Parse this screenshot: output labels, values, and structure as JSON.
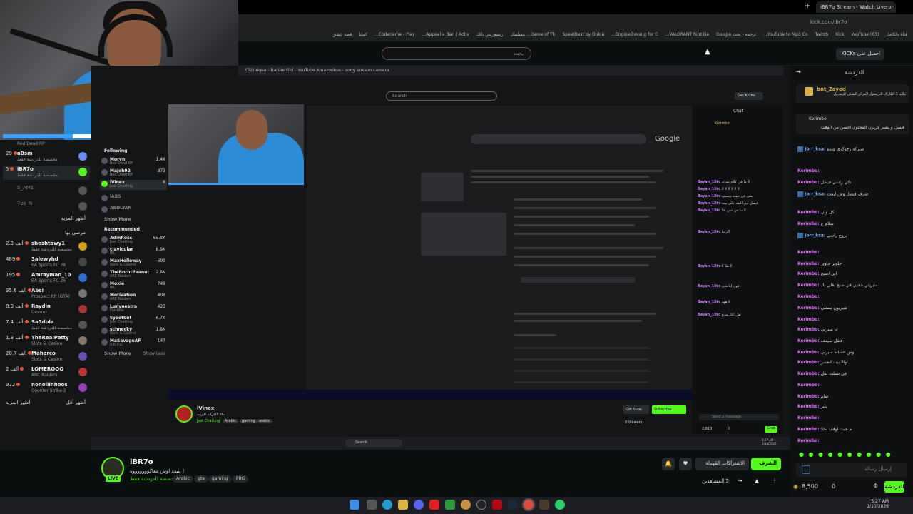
{
  "browser": {
    "active_tab": "iBR7o Stream - Watch Live on Kick",
    "new_tab_symbol": "+",
    "address": "kick.com/ibr7o",
    "bookmarks": [
      "قناة بالكامل",
      "YouTube (63)",
      "Kick",
      "Twitch",
      "YouTube to Mp3 Co...",
      "ترجمه - بحث Google",
      "VALORANT Riot Ga...",
      "EngineOwning for C...",
      "Speedtest by Ookla",
      "Game of Th... مسلسل",
      "زيسوريس بالك",
      "Appeal a Ban | Activ...",
      "Codename - Play...",
      "كمانا",
      "قصة عشق"
    ]
  },
  "kick_header": {
    "search_placeholder": "بحث",
    "get_kick_button": "احصل على KICKs"
  },
  "left_sidebar": {
    "top_item": {
      "name": "",
      "game": "Red Dead RP"
    },
    "items": [
      {
        "count": "29",
        "name": "aBsm",
        "game": "مخصصة للدردشة فقط",
        "color": "#6b8cff"
      },
      {
        "count": "5",
        "name": "iBR7o",
        "game": "مخصصة للدردشة فقط",
        "color": "#53fc18"
      },
      {
        "count": "",
        "name": "S_AM1",
        "game": "",
        "color": "#555"
      },
      {
        "count": "",
        "name": "7os_N",
        "game": "",
        "color": "#555"
      }
    ],
    "show_more_1": "أظهر المزيد",
    "recommended_heading": "مرصى بها",
    "recommended": [
      {
        "count": "2.3 ألف",
        "name": "sheshtawy1",
        "game": "مخصصة للدردشة فقط"
      },
      {
        "count": "489",
        "name": "3alewyhd",
        "game": "EA Sports FC 26"
      },
      {
        "count": "195",
        "name": "Amrayman_10",
        "game": "EA Sports FC 26"
      },
      {
        "count": "35.6 ألف",
        "name": "Absi",
        "game": "Prospect RP (GTA)"
      },
      {
        "count": "8.9 ألف",
        "name": "Raydin",
        "game": "Devour"
      },
      {
        "count": "7.4 ألف",
        "name": "Sa3dola",
        "game": "مخصصة للدردشة فقط"
      },
      {
        "count": "1.3 ألف",
        "name": "TheRealPatty",
        "game": "Slots & Casino"
      },
      {
        "count": "20.7 ألف",
        "name": "Maherco",
        "game": "Slots & Casino"
      },
      {
        "count": "2 ألف",
        "name": "LOMEROOO",
        "game": "ARC Raiders"
      },
      {
        "count": "972",
        "name": "nonoliinhoos",
        "game": "Counter-Strike 2"
      }
    ],
    "show_more_2": "أظهر المزيد",
    "show_less": "أظهر أقل"
  },
  "inner_screen": {
    "tabs": "(52) Aqua - Barbie Girl - YouTube   Amazonkus - sony stream camera",
    "search_placeholder": "Search",
    "get_kicks": "Get KICKs",
    "following_heading": "Following",
    "following": [
      {
        "name": "Morvn",
        "sub": "Red Dead RP",
        "count": "1.4K"
      },
      {
        "name": "Majeh92",
        "sub": "Red Dead RP",
        "count": "873"
      },
      {
        "name": "iVinex",
        "sub": "Just Chatting",
        "count": "8"
      },
      {
        "name": "iABS",
        "sub": "",
        "count": ""
      },
      {
        "name": "ABDLYAN",
        "sub": "",
        "count": ""
      }
    ],
    "show_more": "Show More",
    "recommended_heading": "Recommended",
    "recommended": [
      {
        "name": "AdinRoss",
        "sub": "Just Chatting",
        "count": "65.8K"
      },
      {
        "name": "clavicular",
        "sub": "IRL",
        "count": "8.9K"
      },
      {
        "name": "MaxHolloway",
        "sub": "Slots & Casino",
        "count": "699"
      },
      {
        "name": "TheBurntPeanut",
        "sub": "ARC Raiders",
        "count": "2.8K"
      },
      {
        "name": "Moxie",
        "sub": "IRL",
        "count": "749"
      },
      {
        "name": "Motivation",
        "sub": "ARC Raiders",
        "count": "408"
      },
      {
        "name": "Lunynestra",
        "sub": "Fortnite",
        "count": "423"
      },
      {
        "name": "kyootbot",
        "sub": "Just Chatting",
        "count": "6.7K"
      },
      {
        "name": "schnecky",
        "sub": "Slots & Casino",
        "count": "1.8K"
      },
      {
        "name": "MaSavageAF",
        "sub": "R.E.P.O.",
        "count": "147"
      }
    ],
    "show_more_2": "Show More",
    "show_less": "Show Less",
    "google_logo": "Google",
    "chat_title": "Chat",
    "chat_pinned_user": "Kerimbo",
    "chat_messages": [
      {
        "user": "Bayan_10rc",
        "text": "لا ما في كلام سرنه"
      },
      {
        "user": "Bayan_10rc",
        "text": "لا لا لا لا لا لا"
      },
      {
        "user": "Bayan_10rc",
        "text": "متى في حفله رسمي"
      },
      {
        "user": "Bayan_10rc",
        "text": "فيصل ابي البث على بيت"
      },
      {
        "user": "Bayan_10rc",
        "text": "لا ما في شي هلا"
      },
      {
        "user": "Bayan_10rc",
        "text": "الرانيا"
      },
      {
        "user": "Bayan_10rc",
        "text": "لا هلا لا"
      },
      {
        "user": "Bayan_10rc",
        "text": "قول لنا شي"
      },
      {
        "user": "Bayan_10rc",
        "text": "لا ههه"
      },
      {
        "user": "Bayan_10rc",
        "text": "نقل انك مذيع"
      }
    ],
    "send_placeholder": "Send a message",
    "chat_send": "Chat",
    "points": "2,810",
    "zero": "0",
    "streamer_name": "iVinex",
    "streamer_title": "ملك الكراث البرتبه",
    "streamer_cat": "Just Chatting",
    "streamer_tags": [
      "Arabic",
      "gaming",
      "arabic"
    ],
    "gift_sub": "Gift Subs",
    "subscribe": "Subscribe",
    "viewers": "8 Viewers",
    "taskbar_search": "Search",
    "clock": "5:27 AM\n1/10/2026"
  },
  "stream": {
    "streamer_name": "iBR7o",
    "live": "LIVE",
    "title": "بثيت اوش معاكوووووووه !",
    "category": "مخصصة للدردشة فقط",
    "tags": [
      "Arabic",
      "gta",
      "gaming",
      "FRG"
    ],
    "follow_button": "الشرف",
    "subs_button": "الاشتراكات المُهداة",
    "viewers": "5 المشاهدين",
    "bell_icon": "bell-icon",
    "heart_icon": "heart-icon"
  },
  "chat": {
    "title": "الدردشة",
    "pinned_user": "bnt_Zayed",
    "pinned_text": "إعلانه 1 الكاراك الـرسـول المركز الشـان الرسـول",
    "pinned2_user": "Kerimbo",
    "pinned2_text": "فيصل و بشير كريرن المحتوى احسن من الوقت",
    "messages": [
      {
        "user": "Jorr_ksa:",
        "text": "سيركه رجوكري وووو",
        "style": "u2"
      },
      {
        "user": "Kerimbo:",
        "text": "",
        "style": "u"
      },
      {
        "user": "Kerimbo:",
        "text": "نكي راسي فيصل",
        "style": "u"
      },
      {
        "user": "Jorr_ksa:",
        "text": "شرف فيصل وش ليمت",
        "style": "u2"
      },
      {
        "user": "Kerimbo:",
        "text": "كل ولي",
        "style": "u"
      },
      {
        "user": "Kerimbo:",
        "text": "سلام ج",
        "style": "u"
      },
      {
        "user": "Jorr_ksa:",
        "text": "بروح راسي",
        "style": "u2"
      },
      {
        "user": "Kerimbo:",
        "text": "",
        "style": "u"
      },
      {
        "user": "Kerimbo:",
        "text": "خلوير خلوير",
        "style": "u"
      },
      {
        "user": "Kerimbo:",
        "text": "ابي اصبح",
        "style": "u"
      },
      {
        "user": "Kerimbo:",
        "text": "سيريني حجيي في صبح اهلي بك",
        "style": "u"
      },
      {
        "user": "Kerimbo:",
        "text": "",
        "style": "u"
      },
      {
        "user": "Kerimbo:",
        "text": "شيريون يستلي",
        "style": "u"
      },
      {
        "user": "Kerimbo:",
        "text": "",
        "style": "u"
      },
      {
        "user": "Kerimbo:",
        "text": "انا سيرلي",
        "style": "u"
      },
      {
        "user": "Kerimbo:",
        "text": "فتقل سيمعه",
        "style": "u"
      },
      {
        "user": "Kerimbo:",
        "text": "وش عسانه سيرلي",
        "style": "u"
      },
      {
        "user": "Kerimbo:",
        "text": "اوالا بيت القسر",
        "style": "u"
      },
      {
        "user": "Kerimbo:",
        "text": "في تسلت تمل",
        "style": "u"
      },
      {
        "user": "Kerimbo:",
        "text": "",
        "style": "u"
      },
      {
        "user": "Kerimbo:",
        "text": "تمام",
        "style": "u"
      },
      {
        "user": "Kerimbo:",
        "text": "بلبر",
        "style": "u"
      },
      {
        "user": "Kerimbo:",
        "text": "",
        "style": "u"
      },
      {
        "user": "Kerimbo:",
        "text": "م جيت اوقف نخلا",
        "style": "u"
      },
      {
        "user": "Kerimbo:",
        "text": "",
        "style": "u"
      }
    ],
    "input_placeholder": "إرسال رسالة",
    "send_button": "الدردشة",
    "points": "8,500",
    "zero": "0"
  },
  "os": {
    "clock_time": "5:27 AM",
    "clock_date": "1/10/2026"
  },
  "colors": {
    "accent": "#53fc18",
    "background": "#0b0e0f",
    "panel": "#141517"
  }
}
